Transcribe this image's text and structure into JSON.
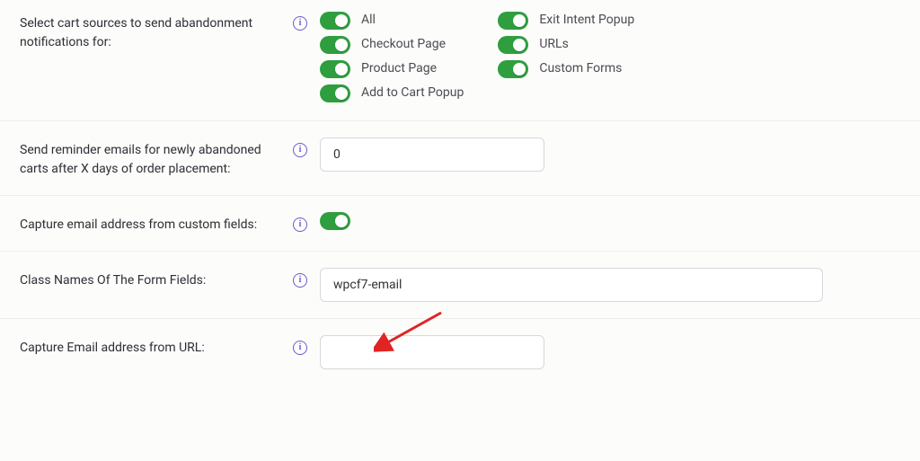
{
  "rows": {
    "cartSources": {
      "label": "Select cart sources to send abandonment notifications for:",
      "left": [
        {
          "label": "All"
        },
        {
          "label": "Checkout Page"
        },
        {
          "label": "Product Page"
        },
        {
          "label": "Add to Cart Popup"
        }
      ],
      "right": [
        {
          "label": "Exit Intent Popup"
        },
        {
          "label": "URLs"
        },
        {
          "label": "Custom Forms"
        }
      ]
    },
    "reminderDays": {
      "label": "Send reminder emails for newly abandoned carts after X days of order placement:",
      "value": "0"
    },
    "captureCustom": {
      "label": "Capture email address from custom fields:"
    },
    "classNames": {
      "label": "Class Names Of The Form Fields:",
      "value": "wpcf7-email"
    },
    "captureUrl": {
      "label": "Capture Email address from URL:",
      "value": ""
    }
  }
}
